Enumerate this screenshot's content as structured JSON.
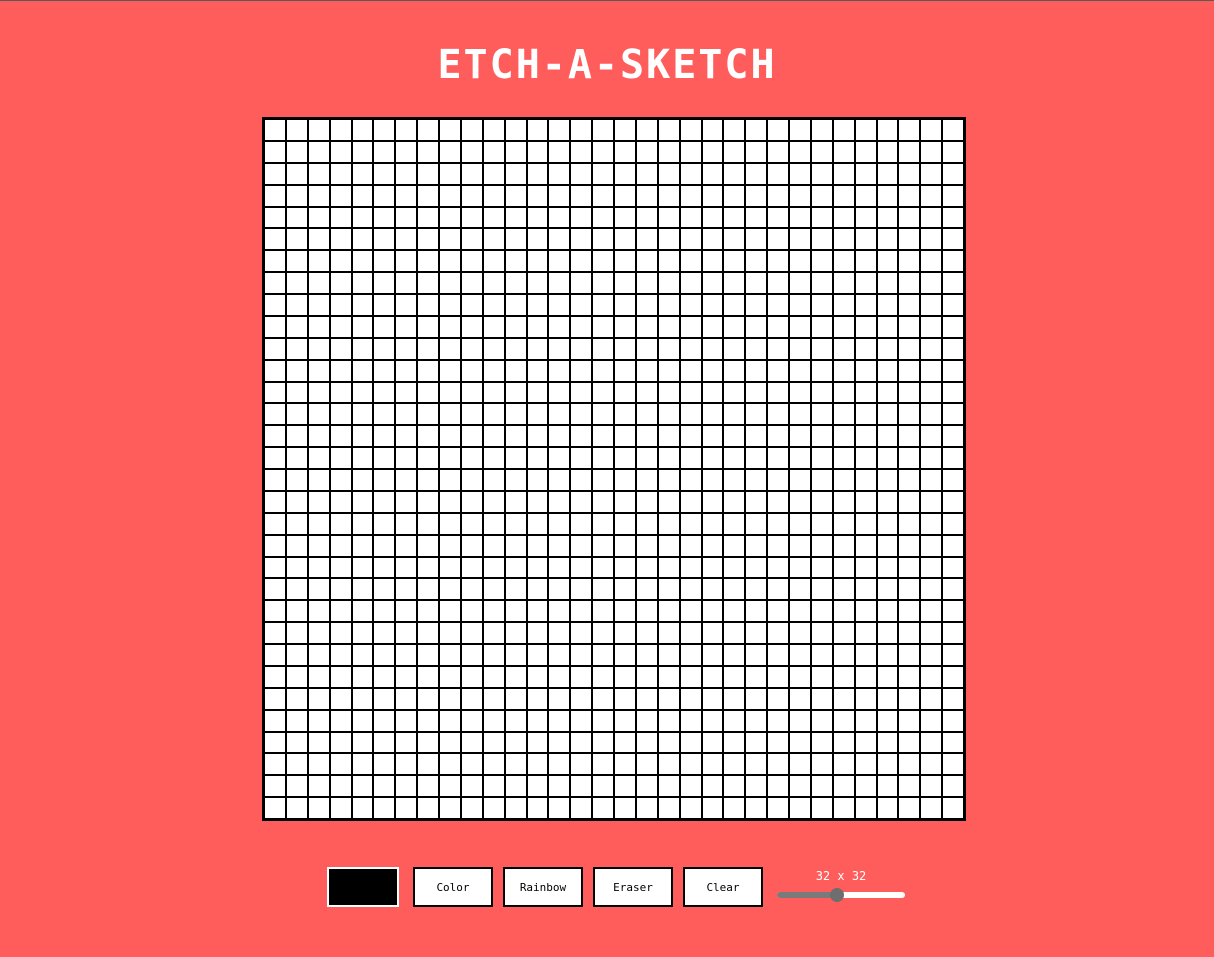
{
  "title": "ETCH-A-SKETCH",
  "grid": {
    "rows": 32,
    "cols": 32,
    "cell_color": "#ffffff",
    "line_color": "#000000"
  },
  "colors": {
    "background": "#ff5c5c",
    "selected_color": "#000000"
  },
  "controls": {
    "color_label": "Color",
    "rainbow_label": "Rainbow",
    "eraser_label": "Eraser",
    "clear_label": "Clear"
  },
  "size": {
    "label": "32 x 32",
    "value": 32,
    "min": 1,
    "max": 64,
    "fraction": 0.47
  }
}
